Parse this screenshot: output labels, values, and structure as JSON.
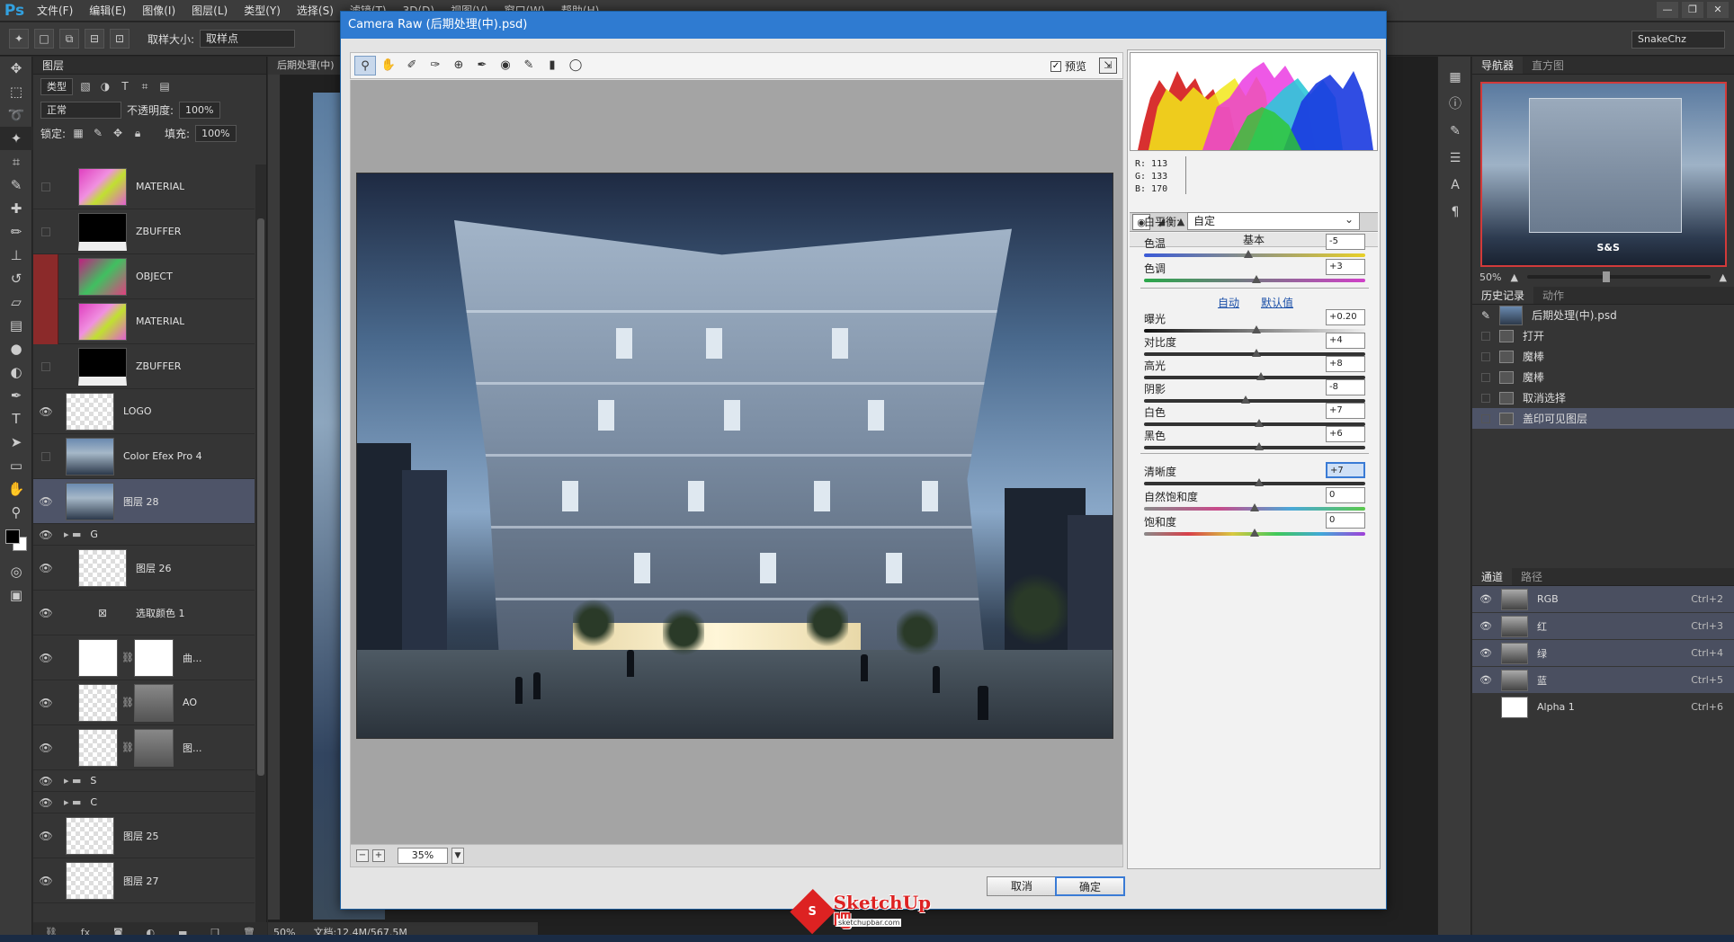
{
  "menubar": {
    "app": "Ps",
    "items": [
      "文件(F)",
      "编辑(E)",
      "图像(I)",
      "图层(L)",
      "类型(Y)",
      "选择(S)",
      "滤镜(T)",
      "3D(D)",
      "视图(V)",
      "窗口(W)",
      "帮助(H)"
    ]
  },
  "options": {
    "sample_size_label": "取样大小:",
    "sample_size_value": "取样点",
    "workspace": "SnakeChz"
  },
  "layers_panel": {
    "tab": "图层",
    "filter_kind": "类型",
    "blend_mode": "正常",
    "opacity_label": "不透明度:",
    "opacity": "100%",
    "lock_label": "锁定:",
    "fill_label": "填充:",
    "fill": "100%",
    "layers": [
      {
        "name": "MATERIAL",
        "thumb": "pink",
        "vis": "box",
        "indent": true
      },
      {
        "name": "ZBUFFER",
        "thumb": "black",
        "vis": "box",
        "indent": true
      },
      {
        "name": "OBJECT",
        "thumb": "green",
        "vis": "red",
        "indent": true
      },
      {
        "name": "MATERIAL",
        "thumb": "pink",
        "vis": "red",
        "indent": true
      },
      {
        "name": "ZBUFFER",
        "thumb": "black",
        "vis": "box",
        "indent": true
      },
      {
        "name": "LOGO",
        "thumb": "checker",
        "vis": "eye"
      },
      {
        "name": "Color Efex Pro 4",
        "thumb": "photo",
        "vis": "box"
      },
      {
        "name": "图层 28",
        "thumb": "photo",
        "vis": "eye",
        "selected": true
      },
      {
        "name": "G",
        "type": "group",
        "vis": "eye"
      },
      {
        "name": "图层 26",
        "thumb": "checker",
        "vis": "eye",
        "indent": true
      },
      {
        "name": "选取颜色 1",
        "type": "adjust",
        "vis": "eye",
        "indent": true
      },
      {
        "name": "曲...",
        "thumb": "white",
        "vis": "eye",
        "mask": true,
        "indent": true
      },
      {
        "name": "AO",
        "thumb": "checker",
        "vis": "eye",
        "mask": true,
        "indent": true
      },
      {
        "name": "图...",
        "thumb": "checker",
        "vis": "eye",
        "mask": true,
        "indent": true
      },
      {
        "name": "S",
        "type": "group",
        "vis": "eye"
      },
      {
        "name": "C",
        "type": "group",
        "vis": "eye"
      },
      {
        "name": "图层 25",
        "thumb": "checker",
        "vis": "eye"
      },
      {
        "name": "图层 27",
        "thumb": "checker",
        "vis": "eye"
      }
    ]
  },
  "document": {
    "tab": "后期处理(中)",
    "zoom": "50%",
    "doc_size": "文档:12.4M/567.5M"
  },
  "navigator": {
    "tabs": [
      "导航器",
      "直方图"
    ],
    "zoom": "50%",
    "logo": "S&S"
  },
  "history": {
    "tabs": [
      "历史记录",
      "动作"
    ],
    "snapshot": "后期处理(中).psd",
    "items": [
      "打开",
      "魔棒",
      "魔棒",
      "取消选择",
      "盖印可见图层"
    ]
  },
  "channels": {
    "tabs": [
      "通道",
      "路径"
    ],
    "items": [
      {
        "name": "RGB",
        "shortcut": "Ctrl+2"
      },
      {
        "name": "红",
        "shortcut": "Ctrl+3"
      },
      {
        "name": "绿",
        "shortcut": "Ctrl+4"
      },
      {
        "name": "蓝",
        "shortcut": "Ctrl+5"
      },
      {
        "name": "Alpha 1",
        "shortcut": "Ctrl+6"
      }
    ]
  },
  "camera_raw": {
    "title": "Camera Raw (后期处理(中).psd)",
    "preview_label": "预览",
    "zoom": "35%",
    "rgb": {
      "r": "R:  113",
      "g": "G:  133",
      "b": "B:  170"
    },
    "panel_title": "基本",
    "wb_label": "白平衡:",
    "wb_value": "自定",
    "auto": "自动",
    "default": "默认值",
    "sliders": [
      {
        "label": "色温",
        "value": "-5",
        "pos": 0.47,
        "track": "linear-gradient(90deg,#3a5ad8,#e8d028)"
      },
      {
        "label": "色调",
        "value": "+3",
        "pos": 0.51,
        "track": "linear-gradient(90deg,#2aa84a,#d040c8)"
      },
      {
        "label": "曝光",
        "value": "+0.20",
        "pos": 0.51,
        "track": "linear-gradient(90deg,#111,#eee)"
      },
      {
        "label": "对比度",
        "value": "+4",
        "pos": 0.51,
        "track": "#333"
      },
      {
        "label": "高光",
        "value": "+8",
        "pos": 0.53,
        "track": "#333"
      },
      {
        "label": "阴影",
        "value": "-8",
        "pos": 0.46,
        "track": "#333"
      },
      {
        "label": "白色",
        "value": "+7",
        "pos": 0.52,
        "track": "#333"
      },
      {
        "label": "黑色",
        "value": "+6",
        "pos": 0.52,
        "track": "#333"
      },
      {
        "label": "清晰度",
        "value": "+7",
        "pos": 0.52,
        "track": "#333",
        "focused": true
      },
      {
        "label": "自然饱和度",
        "value": "0",
        "pos": 0.5,
        "track": "linear-gradient(90deg,#888,#c84a8a,#4aa8d8,#5ac84a)"
      },
      {
        "label": "饱和度",
        "value": "0",
        "pos": 0.5,
        "track": "linear-gradient(90deg,#888,#d8404a,#d8c840,#40c85a,#40a8d8,#a040d8)"
      }
    ],
    "cancel": "取消",
    "ok": "确定"
  },
  "watermark": {
    "brand": "SketchUp吧",
    "url": "sketchupbar.com",
    "badge": "S"
  }
}
